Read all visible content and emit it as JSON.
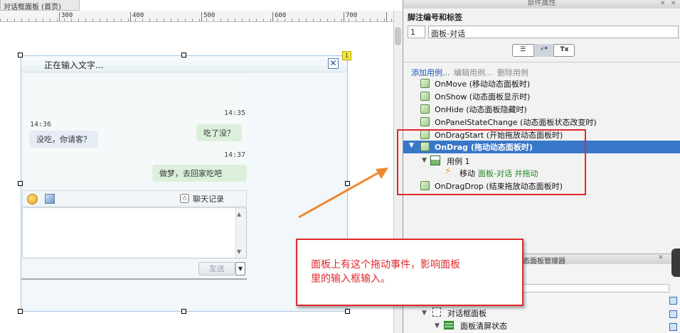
{
  "canvas": {
    "tab_label": "对话框面板 (首页)",
    "ruler_marks": [
      "300",
      "400",
      "500",
      "600",
      "700",
      "800"
    ]
  },
  "panel": {
    "title": "正在输入文字...",
    "badge": "1",
    "messages": [
      {
        "side": "right",
        "time": "14:35",
        "text": "吃了没？"
      },
      {
        "side": "left",
        "time": "14:36",
        "text": "没吃，你请客？"
      },
      {
        "side": "right",
        "time": "14:37",
        "text": "做梦，去回家吃吧"
      }
    ],
    "history_label": "聊天记录",
    "send_label": "发送"
  },
  "props": {
    "window_title": "部件属性",
    "label_heading": "脚注编号和标签",
    "id_value": "1",
    "name_value": "面板-对话",
    "actions": {
      "add": "添加用例...",
      "edit": "编辑用例...",
      "delete": "删除用例"
    },
    "events": [
      "OnMove (移动动态面板时)",
      "OnShow (动态面板显示时)",
      "OnHide (动态面板隐藏时)",
      "OnPanelStateChange (动态面板状态改变时)",
      "OnDragStart (开始拖放动态面板时)",
      "OnDrag (拖动动态面板时)",
      "OnDragDrop (结束拖放动态面板时)"
    ],
    "case_label": "用例 1",
    "action_prefix": "移动",
    "action_target": "面板-对话 并拖动"
  },
  "manager": {
    "title": "态面板管理器",
    "tree_root": "对话框面板",
    "tree_child": "面板清屏状态"
  },
  "annotation": {
    "line1": "面板上有这个拖动事件，影响面板",
    "line2": "里的输入框输入。"
  },
  "colors": {
    "accent_red": "#e0282d",
    "selection_blue": "#3977c9",
    "arrow_orange": "#f0862c"
  }
}
